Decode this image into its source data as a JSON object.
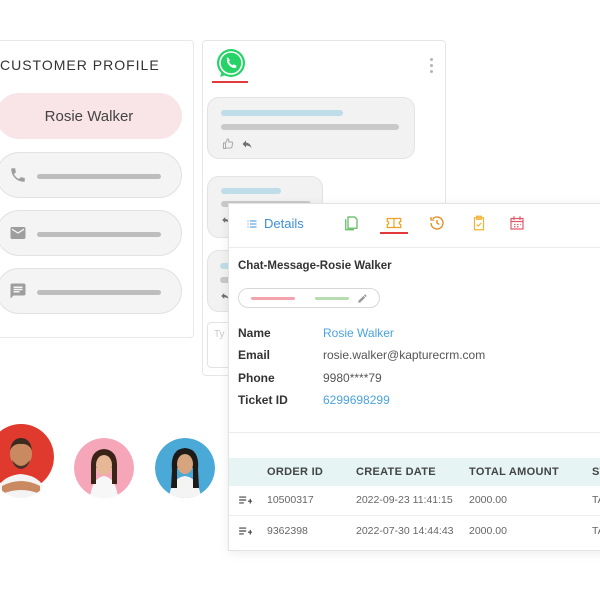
{
  "profile": {
    "title": "CUSTOMER PROFILE",
    "name": "Rosie Walker",
    "fields": [
      {
        "icon": "phone-icon"
      },
      {
        "icon": "mail-icon"
      },
      {
        "icon": "message-icon"
      }
    ]
  },
  "chat": {
    "app_icon": "whatsapp-icon",
    "menu_icon": "kebab-menu-icon",
    "input_placeholder": "Ty",
    "brand_color": "#25d366"
  },
  "detail": {
    "tabs": [
      {
        "name": "details",
        "label": "Details",
        "icon": "list-icon"
      },
      {
        "name": "copy",
        "icon": "copy-icon"
      },
      {
        "name": "ticket",
        "icon": "ticket-icon",
        "active": true
      },
      {
        "name": "history",
        "icon": "history-icon"
      },
      {
        "name": "clipboard",
        "icon": "clipboard-icon"
      },
      {
        "name": "calendar",
        "icon": "calendar-icon"
      }
    ],
    "title": "Chat-Message-Rosie Walker",
    "info": [
      {
        "label": "Name",
        "value": "Rosie Walker",
        "link": true
      },
      {
        "label": "Email",
        "value": "rosie.walker@kapturecrm.com",
        "link": false
      },
      {
        "label": "Phone",
        "value": "9980****79",
        "link": false
      },
      {
        "label": "Ticket ID",
        "value": "6299698299",
        "link": true
      }
    ],
    "table": {
      "headers": [
        "ORDER ID",
        "CREATE DATE",
        "TOTAL AMOUNT",
        "ST"
      ],
      "rows": [
        {
          "order_id": "10500317",
          "create_date": "2022-09-23 11:41:15",
          "total_amount": "2000.00",
          "status": "TA"
        },
        {
          "order_id": "9362398",
          "create_date": "2022-07-30 14:44:43",
          "total_amount": "2000.00",
          "status": "TA"
        }
      ]
    }
  },
  "colors": {
    "accent_red": "#e23a3a",
    "link_blue": "#4aa3df",
    "table_header_bg": "#e6f4f3",
    "name_pill_bg": "#f9e4e7"
  }
}
